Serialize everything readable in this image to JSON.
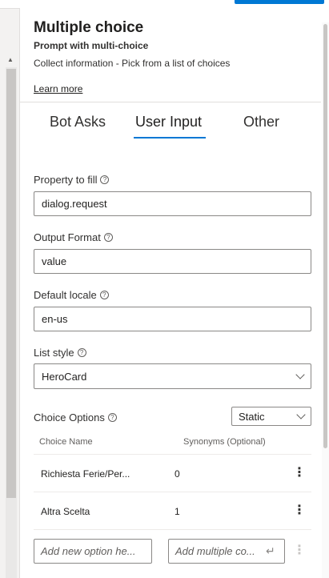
{
  "header": {
    "title": "Multiple choice",
    "subtitle": "Prompt with multi-choice",
    "description": "Collect information - Pick from a list of choices",
    "learn_more": "Learn more"
  },
  "tabs": [
    {
      "label": "Bot Asks",
      "selected": false
    },
    {
      "label": "User Input",
      "selected": true
    },
    {
      "label": "Other",
      "selected": false
    }
  ],
  "fields": {
    "property": {
      "label": "Property to fill",
      "value": "dialog.request"
    },
    "output_format": {
      "label": "Output Format",
      "value": "value"
    },
    "default_locale": {
      "label": "Default locale",
      "value": "en-us"
    },
    "list_style": {
      "label": "List style",
      "value": "HeroCard"
    }
  },
  "choice_options": {
    "label": "Choice Options",
    "mode": "Static",
    "columns": [
      "Choice Name",
      "Synonyms (Optional)"
    ],
    "rows": [
      {
        "name": "Richiesta Ferie/Per...",
        "synonyms": "0"
      },
      {
        "name": "Altra Scelta",
        "synonyms": "1"
      }
    ],
    "add_option_placeholder": "Add new option he...",
    "add_multiple_placeholder": "Add multiple co..."
  },
  "icons": {
    "help": "help-circle-icon",
    "more": "more-vertical-icon",
    "enter": "enter-icon",
    "chevron": "chevron-down-icon"
  },
  "colors": {
    "accent": "#0078d4",
    "text": "#201f1e",
    "border": "#8a8886"
  }
}
